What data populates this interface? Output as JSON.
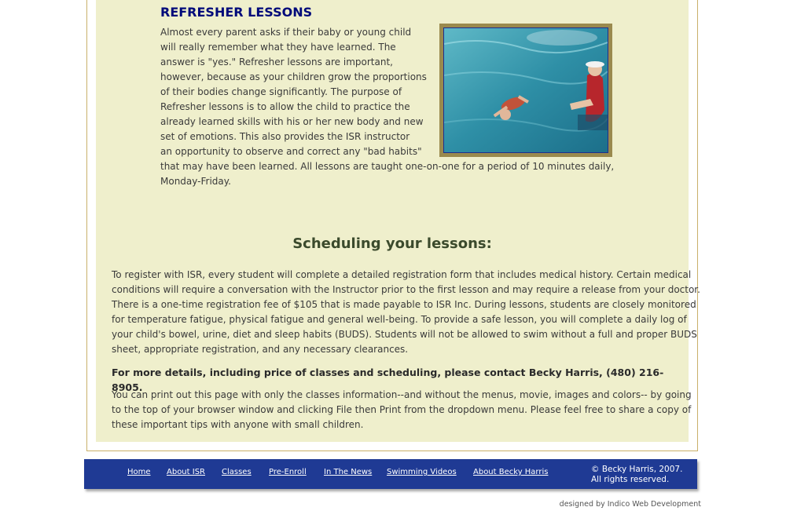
{
  "refresher": {
    "title": "REFRESHER LESSONS",
    "lines": [
      "Almost every parent asks if their baby or young child",
      "will really remember what they have learned. The",
      "answer is \"yes.\" Refresher lessons are important,",
      "however, because as your children grow the proportions",
      "of their bodies change significantly. The purpose of",
      "Refresher lessons is to allow the child to practice the",
      "already learned skills with his or her new body and new",
      "set of emotions. This also provides the ISR instructor",
      "an opportunity to observe and correct any \"bad habits\"",
      "that may have been learned. All lessons are taught one-on-one for a period of 10 minutes daily,",
      "Monday-Friday."
    ]
  },
  "scheduling": {
    "title": "Scheduling your lessons:",
    "register_lines": [
      "To register with ISR, every student will complete a detailed registration form that includes medical history. Certain medical",
      "conditions will require a conversation with the Instructor prior to the first lesson and may require a release from your doctor.",
      "There is a one-time registration fee of $105 that is made payable to ISR Inc. During lessons, students are closely monitored",
      "for temperature fatigue, physical fatigue and general well-being. To provide a safe lesson, you will complete a daily log of",
      "your child's bowel, urine, diet and sleep habits (BUDS). Students will not be allowed to swim without a full and proper BUDS",
      "sheet, appropriate registration, and any necessary clearances."
    ],
    "contact": "For more details, including price of classes and scheduling, please contact Becky Harris, (480) 216-8905.",
    "print_lines": [
      "You can print out this page with only the classes information--and without the menus, movie, images and colors-- by going",
      "to the top of your browser window and clicking File then Print from the dropdown menu. Please feel free to share a copy of",
      "these important tips with anyone with small children."
    ]
  },
  "footer": {
    "nav": [
      "Home",
      "About ISR",
      "Classes",
      "Pre-Enroll",
      "In The News",
      "Swimming Videos",
      "About Becky Harris"
    ],
    "copyright_line1": "© Becky Harris, 2007.",
    "copyright_line2": "All rights reserved."
  },
  "designed_by": "designed by Indico Web Development",
  "colors": {
    "panel": "#efefcc",
    "title": "#000a7a",
    "footer": "#1f3a94",
    "photo_border": "#9a8a4e"
  }
}
